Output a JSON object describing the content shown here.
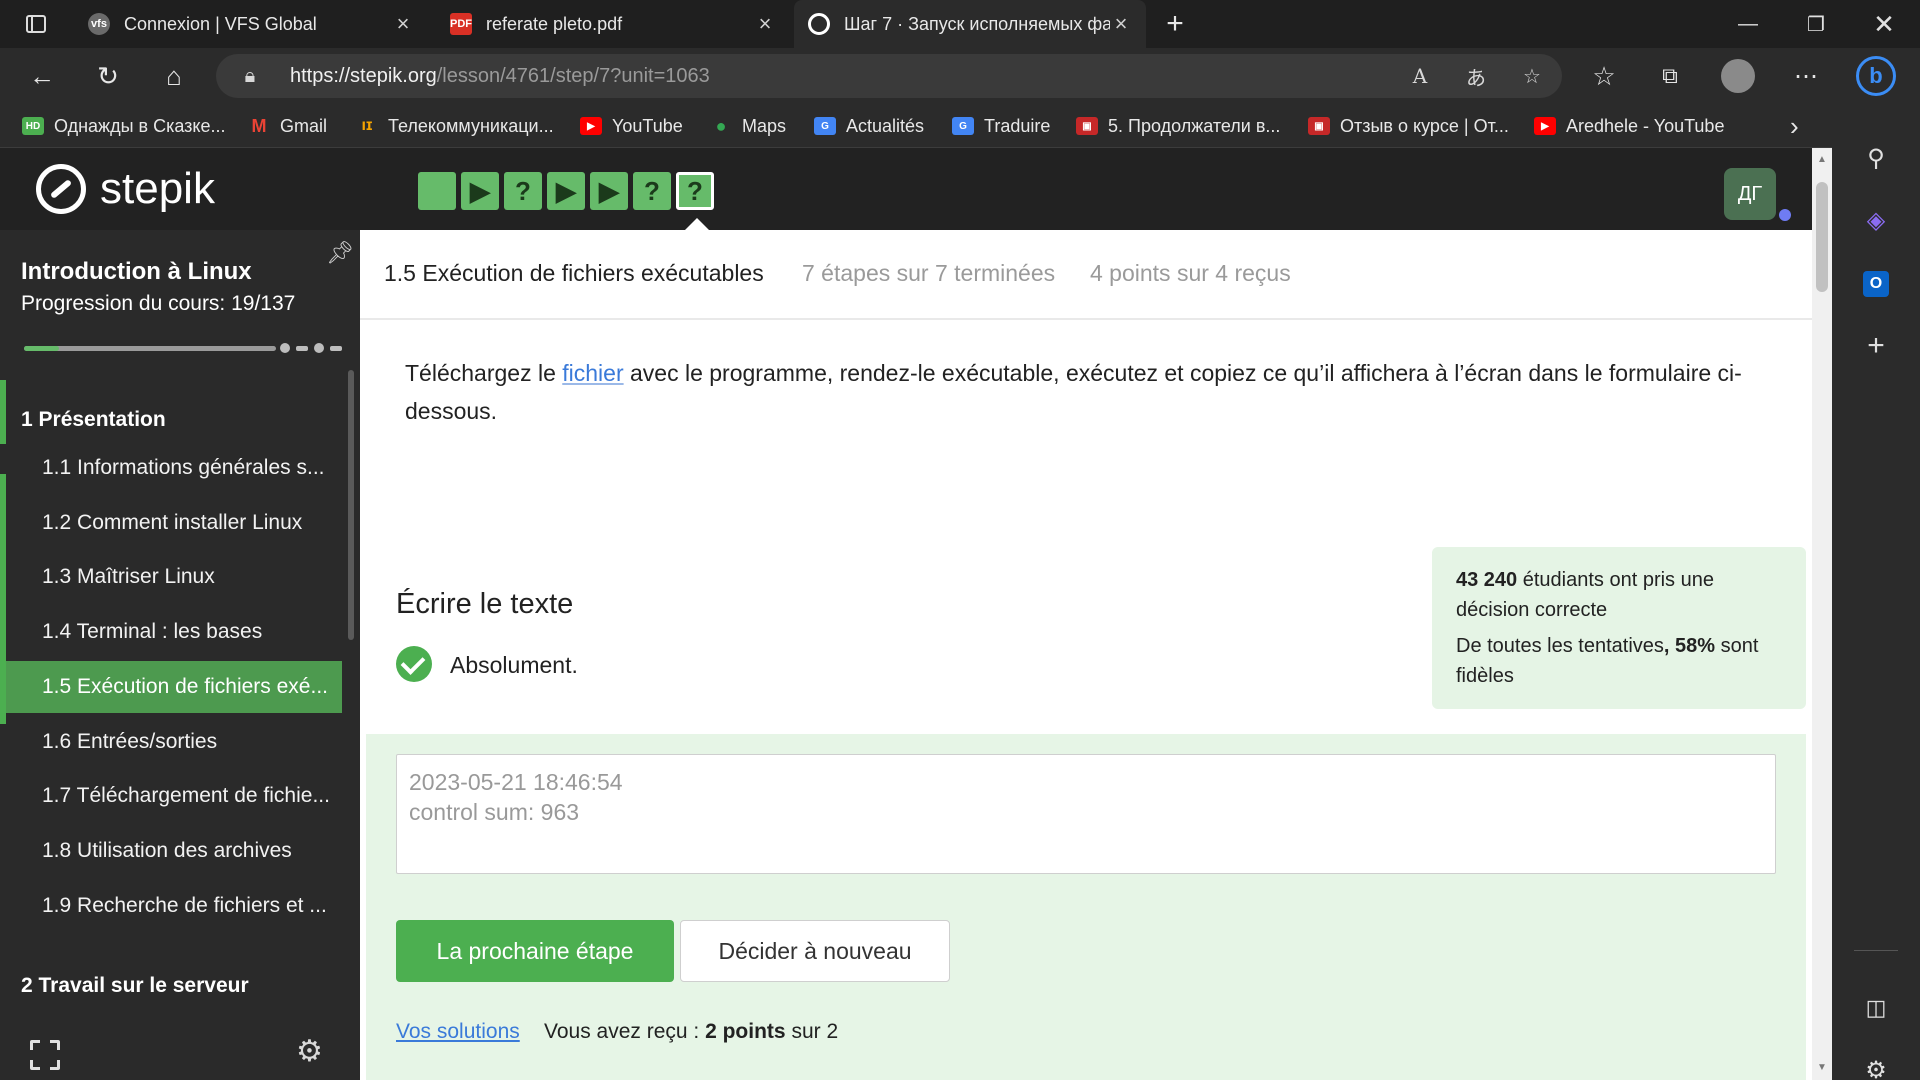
{
  "browser": {
    "tabs": [
      {
        "title": "Connexion | VFS Global",
        "active": false
      },
      {
        "title": "referate pleto.pdf",
        "active": false
      },
      {
        "title": "Шаг 7 · Запуск исполняемых фа",
        "active": true
      }
    ],
    "new_tab_icon": "plus-icon",
    "url_host": "https://stepik.org",
    "url_path": "/lesson/4761/step/7?unit=1063",
    "bookmarks": [
      "Однажды в Сказке...",
      "Gmail",
      "Телекоммуникаци...",
      "YouTube",
      "Maps",
      "Actualités",
      "Traduire",
      "5. Продолжатели в...",
      "Отзыв о курсе | От...",
      "Aredhele - YouTube"
    ]
  },
  "stepik": {
    "logo_text": "stepik",
    "steps": [
      {
        "kind": "text",
        "glyph": ""
      },
      {
        "kind": "video",
        "glyph": "▶"
      },
      {
        "kind": "quiz",
        "glyph": "?"
      },
      {
        "kind": "video",
        "glyph": "▶"
      },
      {
        "kind": "video",
        "glyph": "▶"
      },
      {
        "kind": "quiz",
        "glyph": "?"
      },
      {
        "kind": "quiz",
        "glyph": "?",
        "current": true
      }
    ],
    "avatar_initials": "ДГ",
    "accent_color": "#4caf50"
  },
  "sidebar": {
    "course_title": "Introduction à Linux",
    "progress_label": "Progression du cours: 19/137",
    "progress_fraction": 0.139,
    "module_1": "1 Présentation",
    "lessons": [
      {
        "label": "1.1 Informations générales s...",
        "active": false
      },
      {
        "label": "1.2 Comment installer Linux",
        "active": false
      },
      {
        "label": "1.3 Maîtriser Linux",
        "active": false
      },
      {
        "label": "1.4 Terminal : les bases",
        "active": false
      },
      {
        "label": "1.5 Exécution de fichiers exé...",
        "active": true
      },
      {
        "label": "1.6 Entrées/sorties",
        "active": false
      },
      {
        "label": "1.7 Téléchargement de fichie...",
        "active": false
      },
      {
        "label": "1.8 Utilisation des archives",
        "active": false
      },
      {
        "label": "1.9 Recherche de fichiers et ...",
        "active": false
      }
    ],
    "module_2": "2 Travail sur le serveur"
  },
  "lesson": {
    "title": "1.5 Exécution de fichiers exécutables",
    "steps_done": "7 étapes sur 7 terminées",
    "points": "4 points sur 4 reçus",
    "instruction_before": "Téléchargez le ",
    "instruction_link": "fichier",
    "instruction_after": " avec le programme, rendez-le exécutable, exécutez et copiez ce qu’il affichera à l’écran dans le formulaire ci-dessous.",
    "section_title": "Écrire le texte",
    "result_label": "Absolument.",
    "stats_count": "43 240",
    "stats_line1_rest": " étudiants ont pris une décision correcte",
    "stats_line2_start": "De toutes les tentatives",
    "stats_percent": ", 58%",
    "stats_line2_end": " sont fidèles",
    "answer_text": "2023-05-21 18:46:54\ncontrol sum: 963",
    "next_button": "La prochaine étape",
    "retry_button": "Décider à nouveau",
    "solutions_link": "Vos solutions",
    "points_prefix": "Vous avez reçu : ",
    "points_bold": "2 points",
    "points_suffix": " sur 2"
  }
}
